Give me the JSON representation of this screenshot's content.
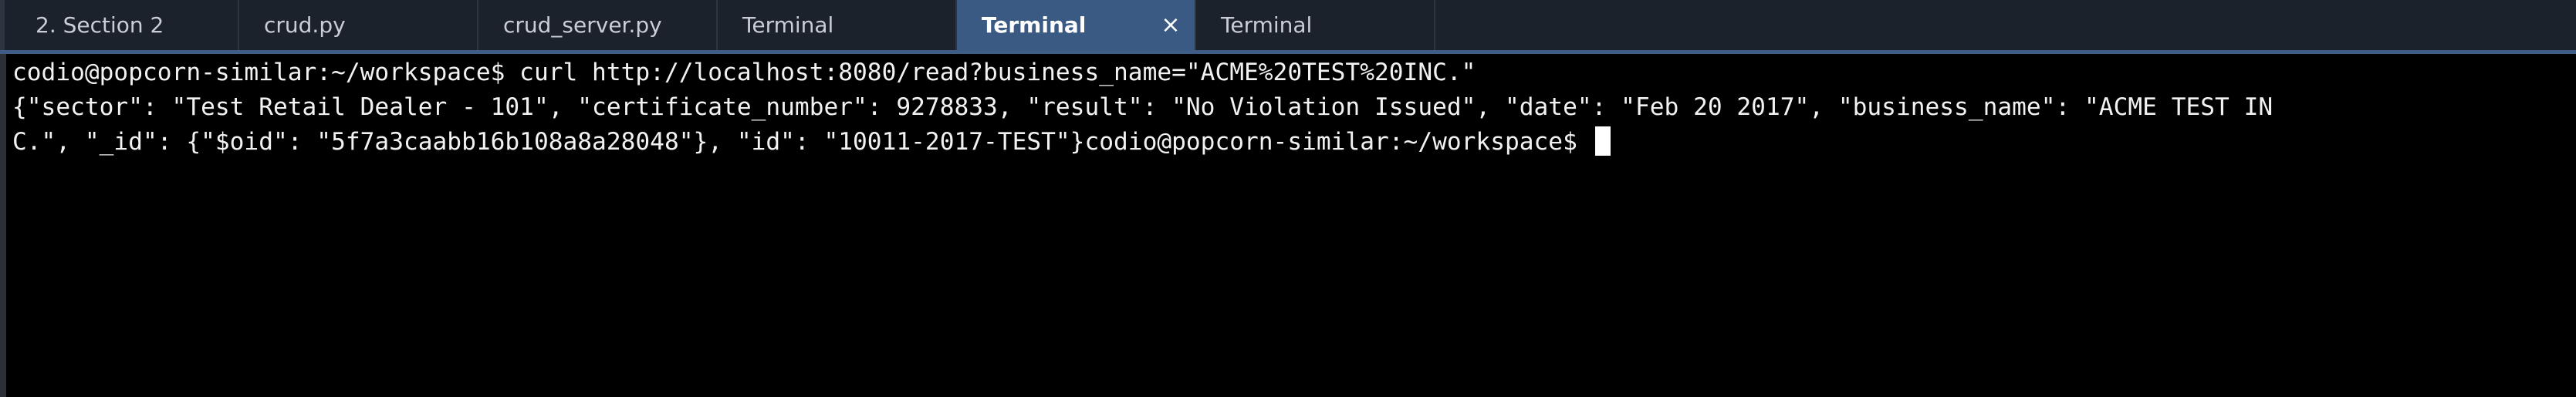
{
  "tabs": [
    {
      "label": "2. Section 2",
      "active": false
    },
    {
      "label": "crud.py",
      "active": false
    },
    {
      "label": "crud_server.py",
      "active": false
    },
    {
      "label": "Terminal",
      "active": false
    },
    {
      "label": "Terminal",
      "active": true,
      "close_icon": "×"
    },
    {
      "label": "Terminal",
      "active": false
    }
  ],
  "terminal": {
    "lines": [
      "codio@popcorn-similar:~/workspace$ curl http://localhost:8080/read?business_name=\"ACME%20TEST%20INC.\"",
      "{\"sector\": \"Test Retail Dealer - 101\", \"certificate_number\": 9278833, \"result\": \"No Violation Issued\", \"date\": \"Feb 20 2017\", \"business_name\": \"ACME TEST IN",
      "C.\", \"_id\": {\"$oid\": \"5f7a3caabb16b108a8a28048\"}, \"id\": \"10011-2017-TEST\"}codio@popcorn-similar:~/workspace$ "
    ]
  },
  "colors": {
    "tab_bar_bg": "#1c222b",
    "active_tab_bg": "#3a5a83",
    "terminal_bg": "#000000",
    "terminal_fg": "#f2f2f2"
  }
}
